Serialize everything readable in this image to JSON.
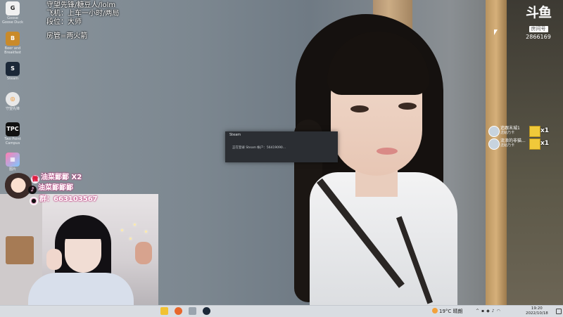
{
  "desktop_icons": [
    {
      "label": "Goose Goose Duck",
      "icon": "goose-icon",
      "glyph": "G"
    },
    {
      "label": "Beer and Breakfast",
      "icon": "beer-icon",
      "glyph": "B"
    },
    {
      "label": "Steam",
      "icon": "steam-icon",
      "glyph": "S"
    },
    {
      "label": "守望先锋",
      "icon": "overwatch-icon",
      "glyph": "◎"
    },
    {
      "label": "Two Point Campus",
      "icon": "tpc-icon",
      "glyph": "TPC"
    },
    {
      "label": "图片",
      "icon": "picture-icon",
      "glyph": "▦"
    }
  ],
  "stream_info": {
    "line1": "守望先锋/糖豆人/lolm",
    "line2": "飞机：上车一小时/两局",
    "line3": "段位：大师",
    "line4": "房管=两火箭"
  },
  "douyu": {
    "logo": "斗鱼",
    "room_label": "房间号",
    "room_number": "2866169"
  },
  "gifts": [
    {
      "name": "追跟末城1",
      "sub": "送給乃卡",
      "count": "x1"
    },
    {
      "name": "流浪的非猫...",
      "sub": "送給乃卡",
      "count": "x1"
    }
  ],
  "steam_dialog": {
    "title": "Steam",
    "message": "正在登录 Steam 帐户：56419090..."
  },
  "socials": {
    "weibo": "油菜鄙鄙 X2",
    "douyin": "油菜鄙鄙鄙",
    "qq": "群：663103567"
  },
  "taskbar": {
    "weather_temp": "19°C",
    "weather_desc": "晴朗",
    "time": "19:20",
    "date": "2022/10/18"
  }
}
